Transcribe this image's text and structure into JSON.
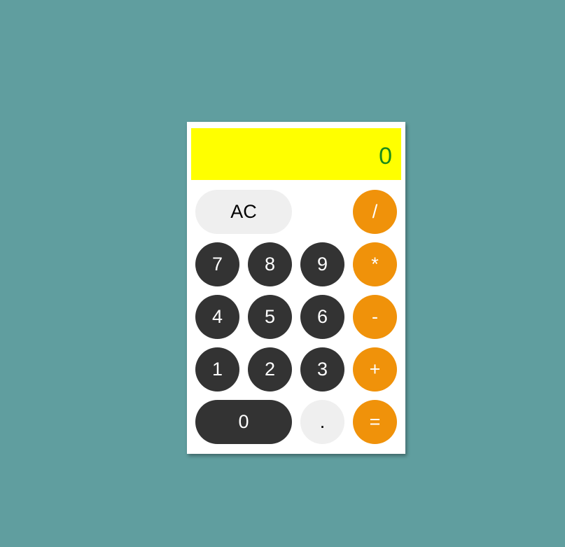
{
  "display": {
    "value": "0"
  },
  "buttons": {
    "clear": "AC",
    "divide": "/",
    "seven": "7",
    "eight": "8",
    "nine": "9",
    "multiply": "*",
    "four": "4",
    "five": "5",
    "six": "6",
    "subtract": "-",
    "one": "1",
    "two": "2",
    "three": "3",
    "add": "+",
    "zero": "0",
    "decimal": ".",
    "equals": "="
  },
  "colors": {
    "background": "#609e9f",
    "display_bg": "#ffff00",
    "display_text": "#1a8a1a",
    "digit_key": "#333333",
    "light_key": "#efefef",
    "operator_key": "#f0920a"
  }
}
